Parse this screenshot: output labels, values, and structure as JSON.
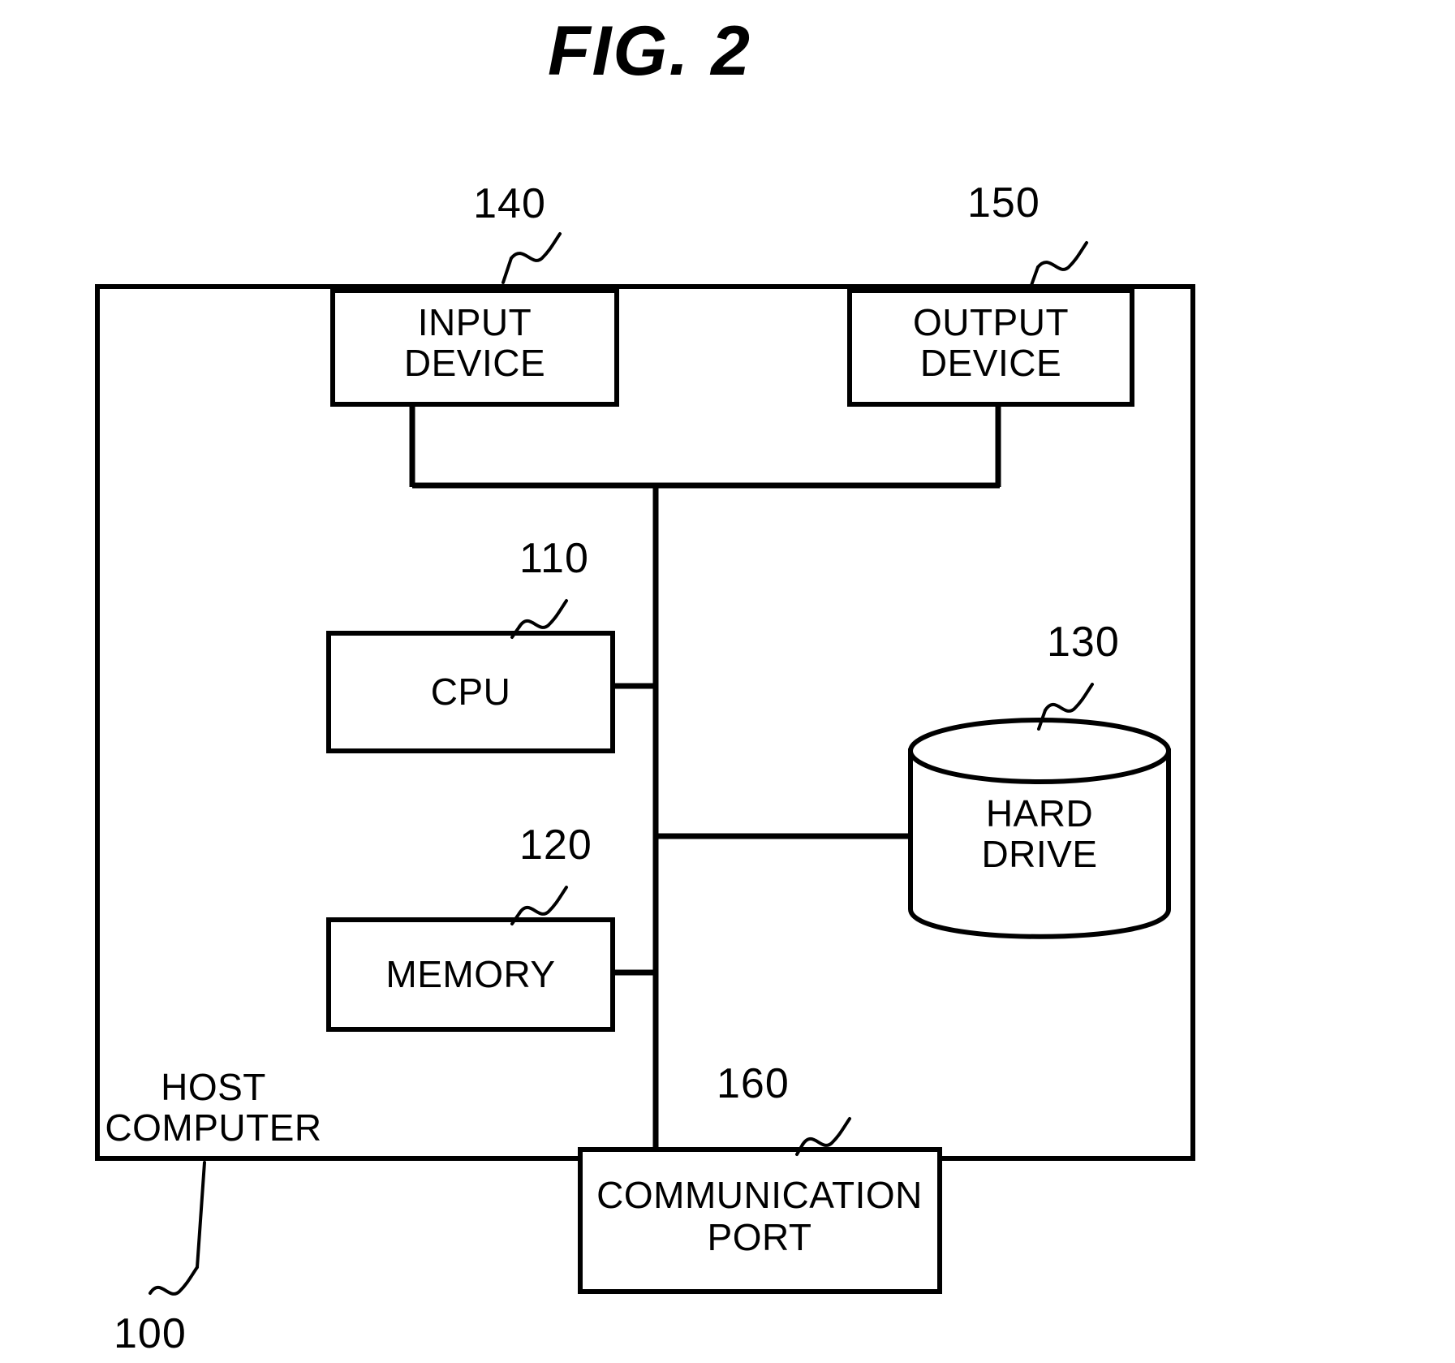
{
  "figure": {
    "title": "FIG.  2",
    "title_plain": "FIG. 2"
  },
  "diagram": {
    "type": "block-diagram",
    "subject": "Host computer hardware architecture",
    "enclosure": {
      "name": "host-computer-frame",
      "label_line_1": "HOST",
      "label_line_2": "COMPUTER",
      "reference_number": "100"
    },
    "blocks": [
      {
        "id": "input-device",
        "shape": "rectangle",
        "label_line_1": "INPUT",
        "label_line_2": "DEVICE",
        "reference_number": "140"
      },
      {
        "id": "output-device",
        "shape": "rectangle",
        "label_line_1": "OUTPUT",
        "label_line_2": "DEVICE",
        "reference_number": "150"
      },
      {
        "id": "cpu",
        "shape": "rectangle",
        "label_line_1": "CPU",
        "label_line_2": "",
        "reference_number": "110"
      },
      {
        "id": "memory",
        "shape": "rectangle",
        "label_line_1": "MEMORY",
        "label_line_2": "",
        "reference_number": "120"
      },
      {
        "id": "hard-drive",
        "shape": "cylinder",
        "label_line_1": "HARD",
        "label_line_2": "DRIVE",
        "reference_number": "130"
      },
      {
        "id": "communication-port",
        "shape": "rectangle",
        "label_line_1": "COMMUNICATION",
        "label_line_2": "PORT",
        "reference_number": "160"
      }
    ],
    "connections": [
      {
        "from": "input-device",
        "to": "bus",
        "style": "solid"
      },
      {
        "from": "output-device",
        "to": "bus",
        "style": "solid"
      },
      {
        "from": "cpu",
        "to": "bus",
        "style": "solid"
      },
      {
        "from": "memory",
        "to": "bus",
        "style": "solid"
      },
      {
        "from": "hard-drive",
        "to": "bus",
        "style": "solid"
      },
      {
        "from": "communication-port",
        "to": "bus",
        "style": "solid"
      }
    ],
    "colors": {
      "stroke": "#000000",
      "background": "#ffffff",
      "text": "#000000"
    }
  }
}
